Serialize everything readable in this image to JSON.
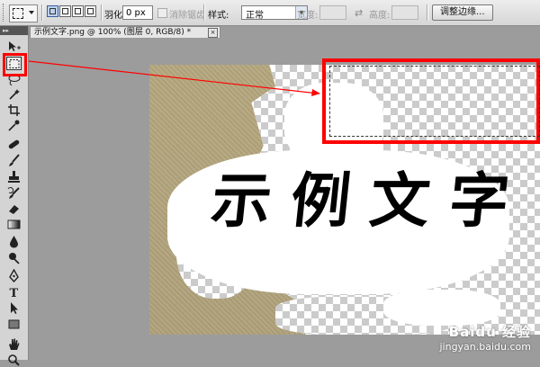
{
  "options_bar": {
    "feather_label": "羽化:",
    "feather_value": "0 px",
    "antialias_label": "消除锯齿",
    "style_label": "样式:",
    "style_value": "正常",
    "width_label": "宽度:",
    "height_label": "高度:",
    "refine_edge_label": "调整边缘..."
  },
  "document": {
    "tab_title": "示例文字.png @ 100% (图层 0, RGB/8) *",
    "close_glyph": "×",
    "text_content": "示例文字"
  },
  "watermark": {
    "brand": "Baidu 经验",
    "url": "jingyan.baidu.com"
  },
  "colors": {
    "highlight": "#ff0000",
    "parchment": "#b9ad86"
  },
  "tools": [
    "move-icon",
    "rect-marquee-icon",
    "lasso-icon",
    "magic-wand-icon",
    "crop-icon",
    "eyedropper-icon",
    "healing-brush-icon",
    "brush-icon",
    "clone-stamp-icon",
    "history-brush-icon",
    "eraser-icon",
    "gradient-icon",
    "blur-icon",
    "dodge-icon",
    "pen-icon",
    "type-icon",
    "path-select-icon",
    "shape-icon",
    "hand-icon",
    "zoom-icon"
  ]
}
